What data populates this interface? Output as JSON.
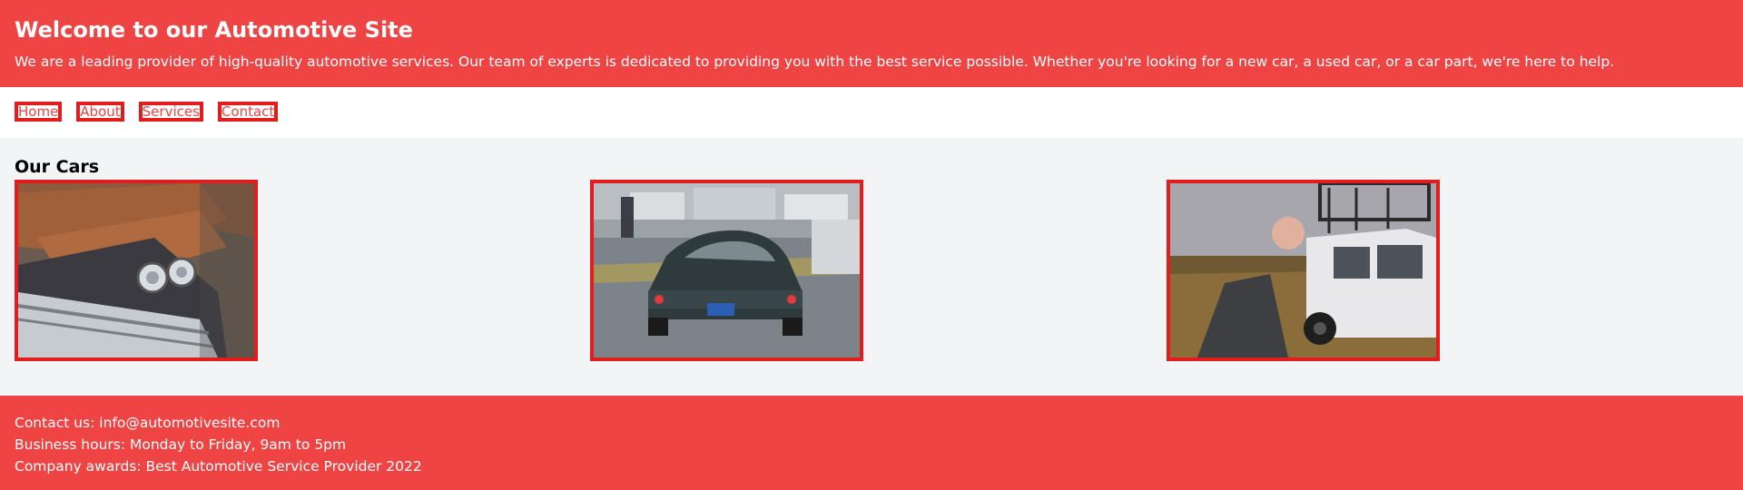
{
  "header": {
    "title": "Welcome to our Automotive Site",
    "intro": "We are a leading provider of high-quality automotive services. Our team of experts is dedicated to providing you with the best service possible. Whether you're looking for a new car, a used car, or a car part, we're here to help."
  },
  "nav": {
    "items": [
      {
        "label": "Home"
      },
      {
        "label": "About"
      },
      {
        "label": "Services"
      },
      {
        "label": "Contact"
      }
    ]
  },
  "main": {
    "heading": "Our Cars",
    "cars": [
      {
        "icon": "vintage-car-photo"
      },
      {
        "icon": "classic-sports-car-photo"
      },
      {
        "icon": "offroad-suv-photo"
      }
    ]
  },
  "footer": {
    "contact": "Contact us: info@automotivesite.com",
    "hours": "Business hours: Monday to Friday, 9am to 5pm",
    "awards": "Company awards: Best Automotive Service Provider 2022"
  },
  "colors": {
    "brand": "#ef4444",
    "border": "#e11d1d",
    "background": "#f3f4f6"
  }
}
